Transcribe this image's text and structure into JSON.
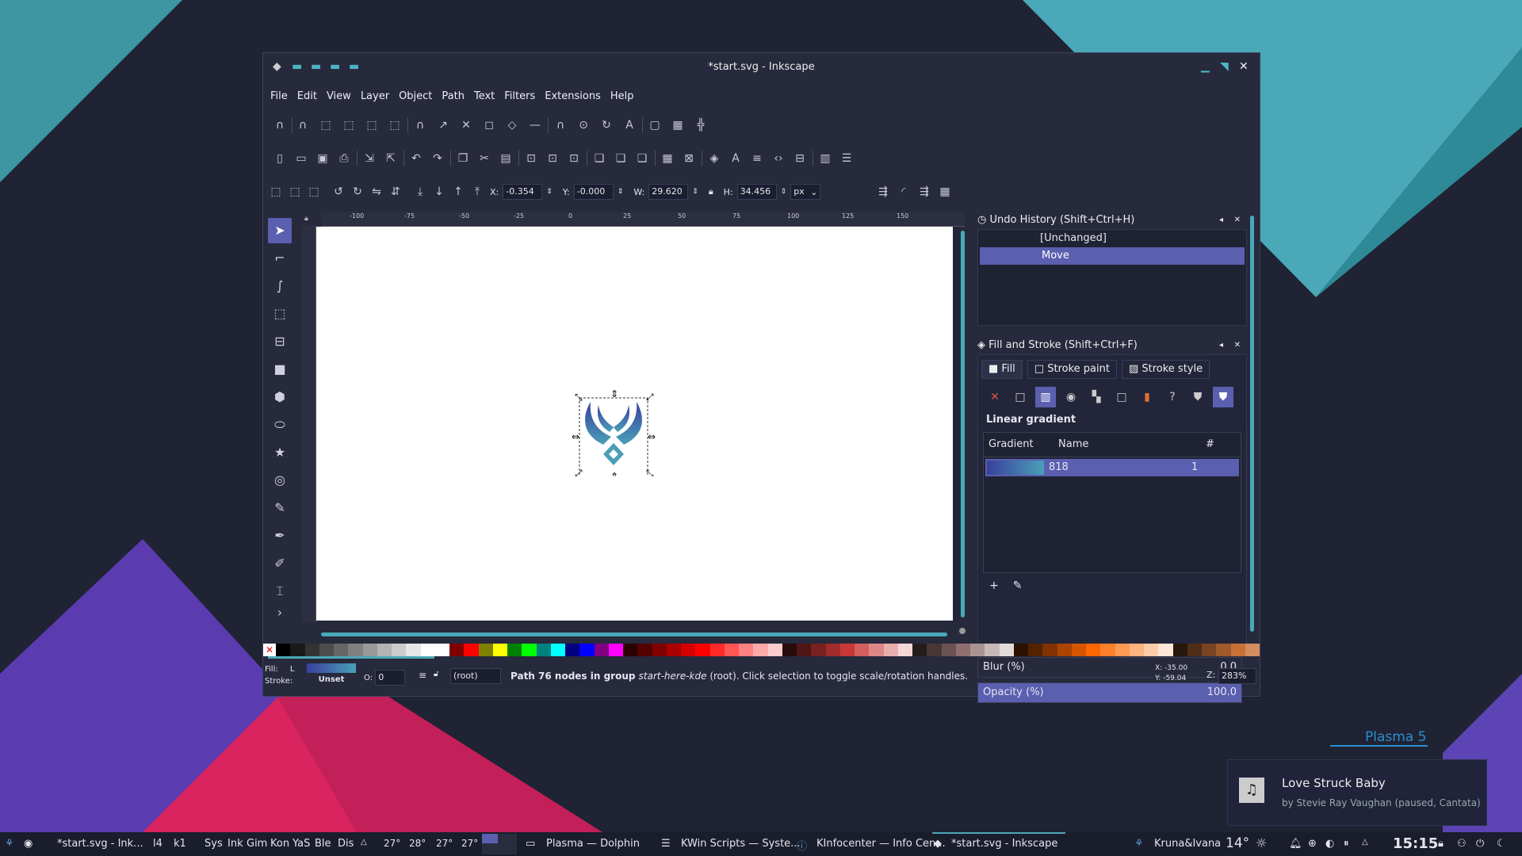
{
  "window": {
    "title": "*start.svg - Inkscape",
    "menu": [
      "File",
      "Edit",
      "View",
      "Layer",
      "Object",
      "Path",
      "Text",
      "Filters",
      "Extensions",
      "Help"
    ]
  },
  "toolbar": {
    "x_label": "X:",
    "x_value": "-0.354",
    "y_label": "Y:",
    "y_value": "-0.000",
    "w_label": "W:",
    "w_value": "29.620",
    "h_label": "H:",
    "h_value": "34.456",
    "unit": "px"
  },
  "ruler": {
    "h_ticks": [
      "-100",
      "-75",
      "-50",
      "-25",
      "0",
      "25",
      "50",
      "75",
      "100",
      "125",
      "150"
    ]
  },
  "undo_panel": {
    "title": "Undo History (Shift+Ctrl+H)",
    "items": [
      "[Unchanged]",
      "Move"
    ],
    "selected": "Move"
  },
  "fill_panel": {
    "title": "Fill and Stroke (Shift+Ctrl+F)",
    "tabs": [
      "Fill",
      "Stroke paint",
      "Stroke style"
    ],
    "paint_type": "Linear gradient",
    "table_headers": [
      "Gradient",
      "Name",
      "#"
    ],
    "rows": [
      {
        "name": "818",
        "count": "1"
      }
    ],
    "blur_label": "Blur (%)",
    "blur_value": "0.0",
    "opacity_label": "Opacity (%)",
    "opacity_value": "100.0"
  },
  "status": {
    "fill_label": "Fill:",
    "fill_short": "L",
    "stroke_label": "Stroke:",
    "stroke_value": "Unset",
    "o_label": "O:",
    "o_value": "0",
    "layer": "(root)",
    "message_pre": "Path 76 nodes in group ",
    "message_em": "start-here-kde",
    "message_post": " (root). Click selection to toggle scale/rotation handles.",
    "coord_x": "X: -35.00",
    "coord_y": "Y: -59.04",
    "zoom_label": "Z:",
    "zoom_value": "283%"
  },
  "taskbar": {
    "launcher": "*start.svg - Ink...",
    "items": [
      "l4",
      "k1",
      "Sys",
      "Ink",
      "Gim",
      "Kon",
      "YaS",
      "Ble",
      "Dis"
    ],
    "temps": [
      "27°",
      "28°",
      "27°",
      "27°"
    ],
    "tasks": [
      "Plasma — Dolphin",
      "KWin Scripts — Syste...",
      "KInfocenter — Info Cen...",
      "*start.svg - Inkscape"
    ],
    "user": "Kruna&Ivana",
    "weather": "14°",
    "clock": "15:15"
  },
  "notification": {
    "title": "Love Struck Baby",
    "subtitle": "by Stevie Ray Vaughan (paused, Cantata)"
  },
  "desktop": {
    "plasma_label": "Plasma 5"
  },
  "colors": {
    "accent": "#5a5fb0",
    "teal": "#4aa8b8",
    "bg": "#1f2333"
  }
}
